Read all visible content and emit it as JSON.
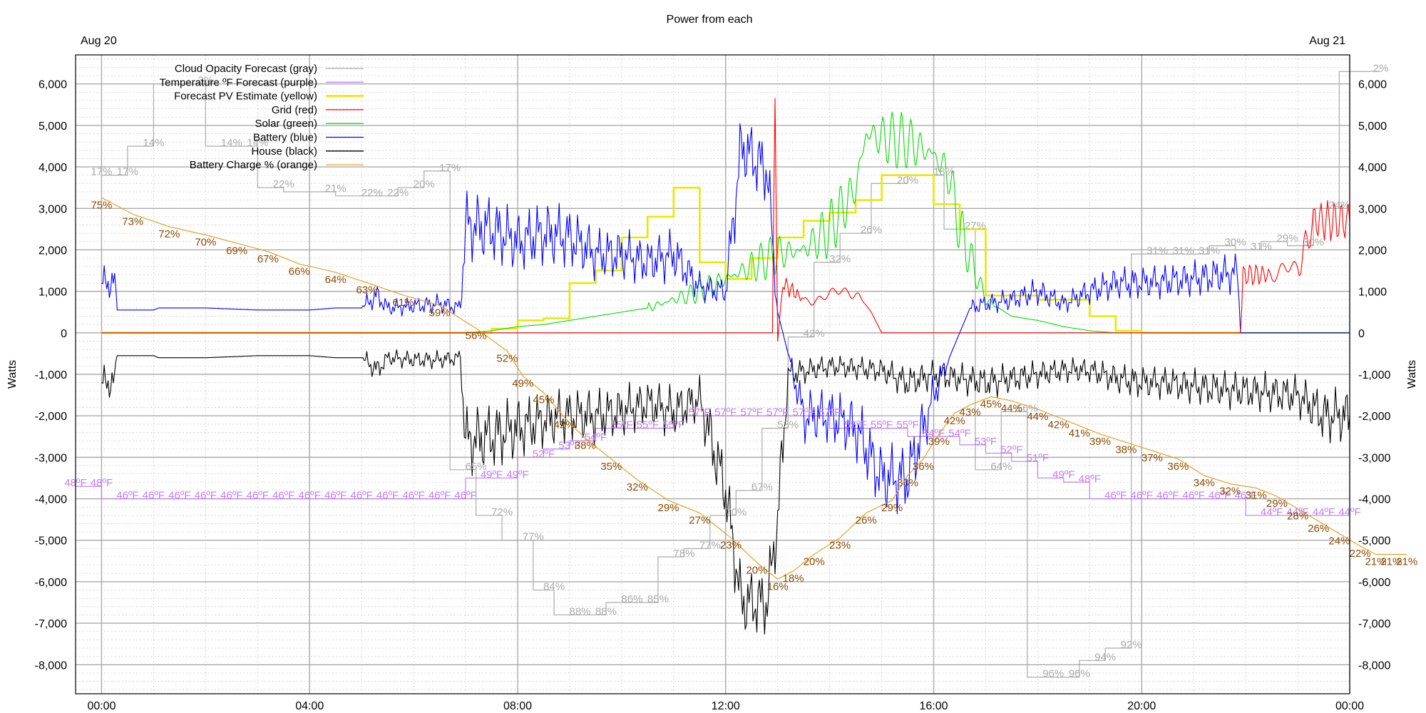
{
  "chart_data": {
    "type": "line",
    "title": "Power from each",
    "ylabel": "Watts",
    "ylabel_right": "Watts",
    "date_labels": [
      "Aug 20",
      "Aug 21"
    ],
    "x_ticks": [
      "00:00",
      "04:00",
      "08:00",
      "12:00",
      "16:00",
      "20:00",
      "00:00"
    ],
    "y_ticks": [
      "6,000",
      "5,000",
      "4,000",
      "3,000",
      "2,000",
      "1,000",
      "0",
      "-1,000",
      "-2,000",
      "-3,000",
      "-4,000",
      "-5,000",
      "-6,000",
      "-7,000",
      "-8,000"
    ],
    "xlim": [
      -0.5,
      24.0
    ],
    "ylim": [
      -8700,
      6700
    ],
    "grid": true,
    "legend_position": "top-left",
    "series": [
      {
        "name": "Cloud Opacity Forecast (gray)",
        "color": "#aaaaaa"
      },
      {
        "name": "Temperature ºF Forecast (purple)",
        "color": "#c07ef0"
      },
      {
        "name": "Forecast PV Estimate (yellow)",
        "color": "#e8e800"
      },
      {
        "name": "Grid (red)",
        "color": "#ff0000"
      },
      {
        "name": "Solar (green)",
        "color": "#00dd00"
      },
      {
        "name": "Battery (blue)",
        "color": "#0000ff"
      },
      {
        "name": "House (black)",
        "color": "#000000"
      },
      {
        "name": "Battery Charge % (orange)",
        "color": "#e8a020"
      }
    ],
    "battery_points": [
      [
        0.0,
        1200
      ],
      [
        0.25,
        1200
      ],
      [
        0.3,
        550
      ],
      [
        1.0,
        550
      ],
      [
        1.1,
        600
      ],
      [
        2.0,
        600
      ],
      [
        3.0,
        550
      ],
      [
        4.0,
        550
      ],
      [
        4.5,
        600
      ],
      [
        5.0,
        600
      ],
      [
        5.3,
        900
      ],
      [
        5.5,
        600
      ],
      [
        6.0,
        650
      ],
      [
        6.5,
        700
      ],
      [
        6.9,
        600
      ],
      [
        7.0,
        2600
      ],
      [
        7.5,
        2500
      ],
      [
        8.0,
        2200
      ],
      [
        8.5,
        2400
      ],
      [
        9.0,
        2300
      ],
      [
        9.5,
        1900
      ],
      [
        10.0,
        1900
      ],
      [
        10.5,
        1700
      ],
      [
        11.0,
        1900
      ],
      [
        11.5,
        1100
      ],
      [
        12.0,
        1000
      ],
      [
        12.3,
        4500
      ],
      [
        12.8,
        3900
      ],
      [
        13.0,
        500
      ],
      [
        13.5,
        -2000
      ],
      [
        14.0,
        -2000
      ],
      [
        14.5,
        -2300
      ],
      [
        15.0,
        -3500
      ],
      [
        15.5,
        -3500
      ],
      [
        16.0,
        -1500
      ],
      [
        16.3,
        -600
      ],
      [
        16.7,
        600
      ],
      [
        17.0,
        700
      ],
      [
        17.5,
        800
      ],
      [
        18.0,
        1000
      ],
      [
        18.5,
        700
      ],
      [
        19.0,
        1000
      ],
      [
        19.5,
        1200
      ],
      [
        20.0,
        1200
      ],
      [
        20.5,
        1250
      ],
      [
        21.0,
        1300
      ],
      [
        21.5,
        1400
      ],
      [
        21.85,
        1450
      ],
      [
        21.9,
        0
      ],
      [
        24.0,
        0
      ]
    ],
    "house_points": [
      [
        0.0,
        -1200
      ],
      [
        0.25,
        -1200
      ],
      [
        0.3,
        -550
      ],
      [
        1.0,
        -550
      ],
      [
        1.1,
        -600
      ],
      [
        2.0,
        -600
      ],
      [
        3.0,
        -550
      ],
      [
        4.0,
        -550
      ],
      [
        4.5,
        -600
      ],
      [
        5.0,
        -600
      ],
      [
        5.3,
        -900
      ],
      [
        5.5,
        -600
      ],
      [
        6.0,
        -650
      ],
      [
        6.5,
        -650
      ],
      [
        6.9,
        -600
      ],
      [
        7.0,
        -2600
      ],
      [
        7.5,
        -2500
      ],
      [
        8.0,
        -2300
      ],
      [
        8.5,
        -2100
      ],
      [
        9.0,
        -2000
      ],
      [
        9.5,
        -2000
      ],
      [
        10.0,
        -1900
      ],
      [
        10.5,
        -1700
      ],
      [
        11.0,
        -1900
      ],
      [
        11.5,
        -1600
      ],
      [
        12.0,
        -3800
      ],
      [
        12.3,
        -6500
      ],
      [
        12.8,
        -6500
      ],
      [
        13.0,
        -4500
      ],
      [
        13.2,
        -1000
      ],
      [
        14.0,
        -800
      ],
      [
        15.0,
        -900
      ],
      [
        15.5,
        -1200
      ],
      [
        16.0,
        -1000
      ],
      [
        16.5,
        -1100
      ],
      [
        17.0,
        -1200
      ],
      [
        17.5,
        -1100
      ],
      [
        18.0,
        -1000
      ],
      [
        18.5,
        -900
      ],
      [
        19.0,
        -900
      ],
      [
        19.5,
        -1100
      ],
      [
        20.0,
        -1200
      ],
      [
        20.5,
        -1200
      ],
      [
        21.0,
        -1300
      ],
      [
        22.0,
        -1400
      ],
      [
        23.0,
        -1500
      ],
      [
        23.5,
        -2000
      ],
      [
        24.0,
        -2000
      ]
    ],
    "solar_points": [
      [
        0.0,
        0
      ],
      [
        7.0,
        0
      ],
      [
        7.5,
        50
      ],
      [
        8.0,
        150
      ],
      [
        8.5,
        200
      ],
      [
        9.0,
        300
      ],
      [
        9.5,
        400
      ],
      [
        10.0,
        500
      ],
      [
        10.5,
        600
      ],
      [
        11.0,
        800
      ],
      [
        11.5,
        1000
      ],
      [
        12.0,
        1300
      ],
      [
        12.5,
        1600
      ],
      [
        13.0,
        1900
      ],
      [
        13.5,
        2000
      ],
      [
        14.0,
        2500
      ],
      [
        14.5,
        3500
      ],
      [
        14.7,
        4800
      ],
      [
        15.0,
        4700
      ],
      [
        15.5,
        4600
      ],
      [
        16.0,
        4300
      ],
      [
        16.3,
        3800
      ],
      [
        16.5,
        2500
      ],
      [
        17.0,
        800
      ],
      [
        17.5,
        400
      ],
      [
        18.0,
        300
      ],
      [
        18.5,
        150
      ],
      [
        19.0,
        50
      ],
      [
        19.5,
        0
      ],
      [
        24.0,
        0
      ]
    ],
    "grid_points": [
      [
        0.0,
        0
      ],
      [
        12.9,
        0
      ],
      [
        12.95,
        6100
      ],
      [
        13.0,
        -200
      ],
      [
        13.1,
        1200
      ],
      [
        13.5,
        800
      ],
      [
        14.0,
        900
      ],
      [
        14.5,
        1000
      ],
      [
        14.8,
        500
      ],
      [
        15.0,
        0
      ],
      [
        21.9,
        0
      ],
      [
        21.95,
        1400
      ],
      [
        22.5,
        1400
      ],
      [
        23.0,
        1500
      ],
      [
        23.3,
        2700
      ],
      [
        24.0,
        2700
      ]
    ],
    "pv_forecast_points": [
      [
        0.0,
        0
      ],
      [
        7.5,
        0
      ],
      [
        7.5,
        100
      ],
      [
        8.0,
        100
      ],
      [
        8.0,
        300
      ],
      [
        8.5,
        300
      ],
      [
        8.5,
        350
      ],
      [
        9.0,
        350
      ],
      [
        9.0,
        1200
      ],
      [
        9.5,
        1200
      ],
      [
        9.5,
        1500
      ],
      [
        10.0,
        1500
      ],
      [
        10.0,
        2300
      ],
      [
        10.5,
        2300
      ],
      [
        10.5,
        2800
      ],
      [
        11.0,
        2800
      ],
      [
        11.0,
        3500
      ],
      [
        11.5,
        3500
      ],
      [
        11.5,
        1700
      ],
      [
        12.0,
        1700
      ],
      [
        12.0,
        1300
      ],
      [
        12.5,
        1300
      ],
      [
        12.5,
        1800
      ],
      [
        13.0,
        1800
      ],
      [
        13.0,
        2300
      ],
      [
        13.5,
        2300
      ],
      [
        13.5,
        2700
      ],
      [
        14.0,
        2700
      ],
      [
        14.0,
        2900
      ],
      [
        14.5,
        2900
      ],
      [
        14.5,
        3200
      ],
      [
        15.0,
        3200
      ],
      [
        15.0,
        3800
      ],
      [
        16.0,
        3800
      ],
      [
        16.0,
        3100
      ],
      [
        16.5,
        3100
      ],
      [
        16.5,
        2500
      ],
      [
        17.0,
        2500
      ],
      [
        17.0,
        900
      ],
      [
        18.0,
        900
      ],
      [
        18.0,
        800
      ],
      [
        19.0,
        800
      ],
      [
        19.0,
        400
      ],
      [
        19.5,
        400
      ],
      [
        19.5,
        50
      ],
      [
        20.0,
        50
      ],
      [
        20.0,
        0
      ],
      [
        24.0,
        0
      ]
    ],
    "battery_charge_labels": [
      [
        0.0,
        3000,
        "75%"
      ],
      [
        0.6,
        2600,
        "73%"
      ],
      [
        1.3,
        2300,
        "72%"
      ],
      [
        2.0,
        2100,
        "70%"
      ],
      [
        2.6,
        1900,
        "69%"
      ],
      [
        3.2,
        1700,
        "67%"
      ],
      [
        3.8,
        1400,
        "66%"
      ],
      [
        4.5,
        1200,
        "64%"
      ],
      [
        5.1,
        950,
        "63%"
      ],
      [
        5.8,
        650,
        "61%"
      ],
      [
        6.5,
        400,
        "59%"
      ],
      [
        7.2,
        -150,
        "56%"
      ],
      [
        7.8,
        -700,
        "52%"
      ],
      [
        8.1,
        -1300,
        "49%"
      ],
      [
        8.5,
        -1700,
        "45%"
      ],
      [
        8.9,
        -2300,
        "42%"
      ],
      [
        9.3,
        -2800,
        "38%"
      ],
      [
        9.8,
        -3300,
        "35%"
      ],
      [
        10.3,
        -3800,
        "32%"
      ],
      [
        10.9,
        -4300,
        "29%"
      ],
      [
        11.5,
        -4600,
        "27%"
      ],
      [
        12.1,
        -5200,
        "23%"
      ],
      [
        12.6,
        -5800,
        "20%"
      ],
      [
        13.0,
        -6200,
        "16%"
      ],
      [
        13.3,
        -6000,
        "18%"
      ],
      [
        13.7,
        -5600,
        "20%"
      ],
      [
        14.2,
        -5200,
        "23%"
      ],
      [
        14.7,
        -4600,
        "26%"
      ],
      [
        15.2,
        -4300,
        "29%"
      ],
      [
        15.5,
        -3700,
        "33%"
      ],
      [
        15.8,
        -3300,
        "36%"
      ],
      [
        16.1,
        -2700,
        "39%"
      ],
      [
        16.4,
        -2200,
        "42%"
      ],
      [
        16.7,
        -2000,
        "43%"
      ],
      [
        17.1,
        -1800,
        "45%"
      ],
      [
        17.5,
        -1900,
        "44%"
      ],
      [
        18.0,
        -2100,
        "44%"
      ],
      [
        18.4,
        -2300,
        "42%"
      ],
      [
        18.8,
        -2500,
        "41%"
      ],
      [
        19.2,
        -2700,
        "39%"
      ],
      [
        19.7,
        -2900,
        "38%"
      ],
      [
        20.2,
        -3100,
        "37%"
      ],
      [
        20.7,
        -3300,
        "36%"
      ],
      [
        21.2,
        -3700,
        "34%"
      ],
      [
        21.7,
        -3900,
        "32%"
      ],
      [
        22.2,
        -4000,
        "31%"
      ],
      [
        22.6,
        -4200,
        "29%"
      ],
      [
        23.0,
        -4500,
        "28%"
      ],
      [
        23.4,
        -4800,
        "26%"
      ],
      [
        23.8,
        -5100,
        "24%"
      ],
      [
        24.2,
        -5400,
        "22%"
      ],
      [
        24.5,
        -5600,
        "21%"
      ],
      [
        24.8,
        -5600,
        "21%"
      ],
      [
        25.1,
        -5600,
        "21%"
      ]
    ],
    "cloud_labels": [
      [
        0.0,
        3800,
        "17%"
      ],
      [
        0.5,
        3800,
        "17%"
      ],
      [
        1.0,
        4500,
        "14%"
      ],
      [
        2.0,
        6000,
        "3%"
      ],
      [
        2.5,
        4500,
        "14%"
      ],
      [
        3.0,
        4500,
        "14%"
      ],
      [
        3.5,
        3500,
        "22%"
      ],
      [
        4.5,
        3400,
        "21%"
      ],
      [
        5.2,
        3300,
        "22%"
      ],
      [
        5.7,
        3300,
        "22%"
      ],
      [
        6.2,
        3500,
        "20%"
      ],
      [
        6.7,
        3900,
        "17%"
      ],
      [
        7.2,
        -3300,
        "65%"
      ],
      [
        7.7,
        -4400,
        "72%"
      ],
      [
        8.3,
        -5000,
        "77%"
      ],
      [
        8.7,
        -6200,
        "84%"
      ],
      [
        9.2,
        -6800,
        "88%"
      ],
      [
        9.7,
        -6800,
        "88%"
      ],
      [
        10.2,
        -6500,
        "86%"
      ],
      [
        10.7,
        -6500,
        "85%"
      ],
      [
        11.2,
        -5400,
        "78%"
      ],
      [
        11.7,
        -5200,
        "77%"
      ],
      [
        12.2,
        -4400,
        "70%"
      ],
      [
        12.7,
        -3800,
        "67%"
      ],
      [
        13.2,
        -2300,
        "53%"
      ],
      [
        13.7,
        -100,
        "42%"
      ],
      [
        14.2,
        1700,
        "32%"
      ],
      [
        14.8,
        2400,
        "26%"
      ],
      [
        15.5,
        3600,
        "20%"
      ],
      [
        16.2,
        3800,
        "18%"
      ],
      [
        16.8,
        2500,
        "27%"
      ],
      [
        17.3,
        -3300,
        "64%"
      ],
      [
        17.8,
        -1900,
        "56%"
      ],
      [
        18.3,
        -8300,
        "96%"
      ],
      [
        18.8,
        -8300,
        "96%"
      ],
      [
        19.3,
        -7900,
        "94%"
      ],
      [
        19.8,
        -7600,
        "92%"
      ],
      [
        20.3,
        1900,
        "31%"
      ],
      [
        20.8,
        1900,
        "31%"
      ],
      [
        21.3,
        1900,
        "31%"
      ],
      [
        21.8,
        2100,
        "30%"
      ],
      [
        22.3,
        2000,
        "31%"
      ],
      [
        22.8,
        2200,
        "29%"
      ],
      [
        23.3,
        2100,
        "30%"
      ],
      [
        23.8,
        3000,
        "24%"
      ],
      [
        24.6,
        6300,
        "2%"
      ]
    ],
    "temperature_labels": [
      [
        -0.5,
        -3700,
        "48ºF"
      ],
      [
        0.0,
        -3700,
        "48ºF"
      ],
      [
        0.5,
        -4000,
        "46ºF"
      ],
      [
        1.0,
        -4000,
        "46ºF"
      ],
      [
        1.5,
        -4000,
        "46ºF"
      ],
      [
        2.0,
        -4000,
        "46ºF"
      ],
      [
        2.5,
        -4000,
        "46ºF"
      ],
      [
        3.0,
        -4000,
        "46ºF"
      ],
      [
        3.5,
        -4000,
        "46ºF"
      ],
      [
        4.0,
        -4000,
        "46ºF"
      ],
      [
        4.5,
        -4000,
        "46ºF"
      ],
      [
        5.0,
        -4000,
        "46ºF"
      ],
      [
        5.5,
        -4000,
        "46ºF"
      ],
      [
        6.0,
        -4000,
        "46ºF"
      ],
      [
        6.5,
        -4000,
        "46ºF"
      ],
      [
        7.0,
        -4000,
        "46ºF"
      ],
      [
        7.5,
        -3500,
        "49ºF"
      ],
      [
        8.0,
        -3500,
        "49ºF"
      ],
      [
        8.5,
        -3000,
        "52ºF"
      ],
      [
        9.0,
        -2800,
        "53ºF"
      ],
      [
        9.5,
        -2600,
        "54ºF"
      ],
      [
        10.0,
        -2300,
        "55ºF"
      ],
      [
        10.5,
        -2300,
        "55ºF"
      ],
      [
        11.0,
        -2300,
        "55ºF"
      ],
      [
        11.5,
        -2000,
        "57ºF"
      ],
      [
        12.0,
        -2000,
        "57ºF"
      ],
      [
        12.5,
        -2000,
        "57ºF"
      ],
      [
        13.0,
        -2000,
        "57ºF"
      ],
      [
        13.5,
        -2000,
        "57ºF"
      ],
      [
        14.0,
        -2000,
        "57ºF"
      ],
      [
        14.5,
        -2300,
        "55ºF"
      ],
      [
        15.0,
        -2300,
        "55ºF"
      ],
      [
        15.5,
        -2300,
        "55ºF"
      ],
      [
        16.0,
        -2500,
        "54ºF"
      ],
      [
        16.5,
        -2500,
        "54ºF"
      ],
      [
        17.0,
        -2700,
        "53ºF"
      ],
      [
        17.5,
        -2900,
        "52ºF"
      ],
      [
        18.0,
        -3100,
        "51ºF"
      ],
      [
        18.5,
        -3500,
        "49ºF"
      ],
      [
        19.0,
        -3600,
        "48ºF"
      ],
      [
        19.5,
        -4000,
        "46ºF"
      ],
      [
        20.0,
        -4000,
        "46ºF"
      ],
      [
        20.5,
        -4000,
        "46ºF"
      ],
      [
        21.0,
        -4000,
        "46ºF"
      ],
      [
        21.5,
        -4000,
        "46ºF"
      ],
      [
        22.0,
        -4000,
        "46ºF"
      ],
      [
        22.5,
        -4400,
        "44ºF"
      ],
      [
        23.0,
        -4400,
        "44ºF"
      ],
      [
        23.5,
        -4400,
        "44ºF"
      ],
      [
        24.0,
        -4400,
        "44ºF"
      ]
    ]
  }
}
